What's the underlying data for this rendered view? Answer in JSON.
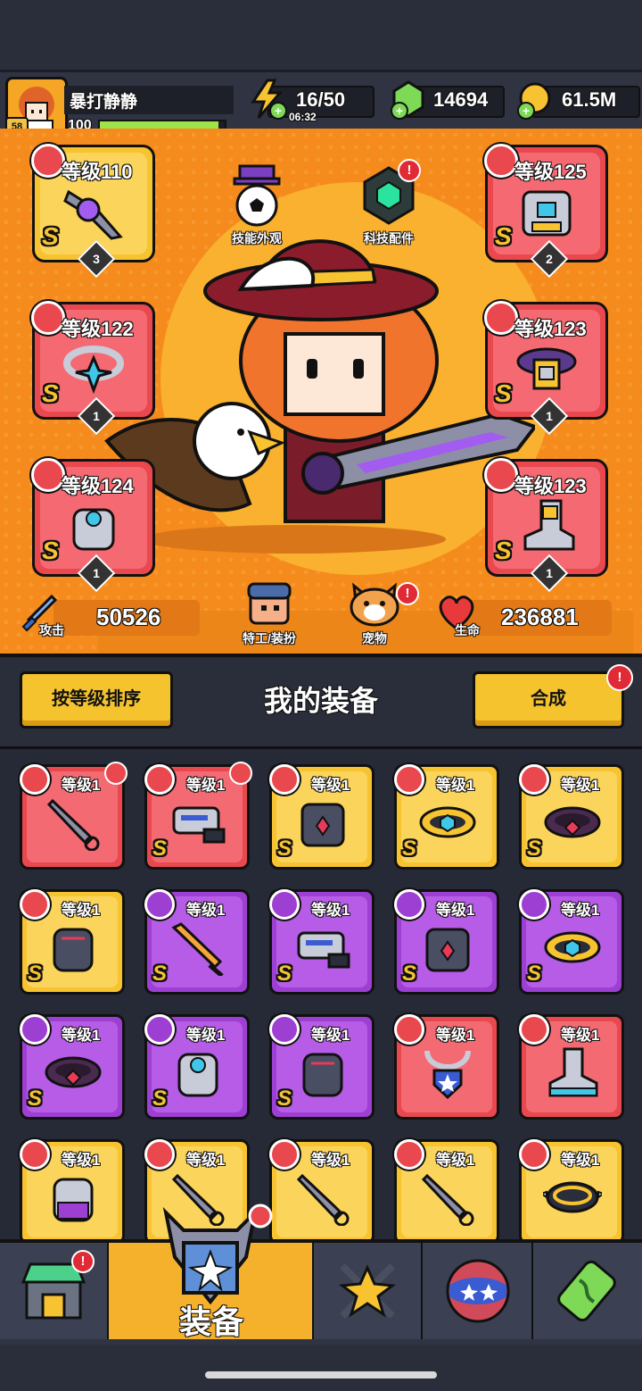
{
  "player": {
    "name": "暴打静静",
    "avatar_level": "58",
    "level": "100",
    "xp_fraction": 0.95
  },
  "resources": {
    "energy": {
      "value": "16/50",
      "timer": "06:32",
      "icon": "lightning-icon"
    },
    "gems": {
      "value": "14694",
      "icon": "green-gem-icon"
    },
    "gold": {
      "value": "61.5M",
      "icon": "gold-coin-icon"
    }
  },
  "hero_slots": [
    {
      "label": "等级110",
      "rank": "S",
      "count": "3",
      "type": "weapon-slot",
      "color": "gold"
    },
    {
      "label": "等级125",
      "rank": "S",
      "count": "2",
      "type": "armor-slot",
      "color": "red"
    },
    {
      "label": "等级122",
      "rank": "S",
      "count": "1",
      "type": "necklace-slot",
      "color": "red"
    },
    {
      "label": "等级123",
      "rank": "S",
      "count": "1",
      "type": "belt-slot",
      "color": "red"
    },
    {
      "label": "等级124",
      "rank": "S",
      "count": "1",
      "type": "glove-slot",
      "color": "red"
    },
    {
      "label": "等级123",
      "rank": "S",
      "count": "1",
      "type": "boot-slot",
      "color": "red"
    }
  ],
  "hero_buttons": {
    "skin": "技能外观",
    "tech": "科技配件",
    "agent": "特工/装扮",
    "pet": "宠物",
    "alert": "!"
  },
  "stats": {
    "attack_label": "攻击",
    "attack_value": "50526",
    "hp_label": "生命",
    "hp_value": "236881"
  },
  "equipment": {
    "sort_button": "按等级排序",
    "title": "我的装备",
    "merge_button": "合成",
    "alert": "!"
  },
  "items": [
    {
      "label": "等级1",
      "rank": "",
      "color": "r",
      "icon": "weapon-icon",
      "art": "kunai"
    },
    {
      "label": "等级1",
      "rank": "S",
      "color": "r",
      "icon": "weapon-icon",
      "art": "gun"
    },
    {
      "label": "等级1",
      "rank": "S",
      "color": "y",
      "icon": "armor-icon",
      "art": "armor"
    },
    {
      "label": "等级1",
      "rank": "S",
      "color": "y",
      "icon": "belt-icon",
      "art": "belt"
    },
    {
      "label": "等级1",
      "rank": "S",
      "color": "y",
      "icon": "belt-icon",
      "art": "belt-dark"
    },
    {
      "label": "等级1",
      "rank": "S",
      "color": "y",
      "icon": "glove-icon",
      "art": "glove"
    },
    {
      "label": "等级1",
      "rank": "S",
      "color": "p",
      "icon": "weapon-icon",
      "art": "sword"
    },
    {
      "label": "等级1",
      "rank": "S",
      "color": "p",
      "icon": "weapon-icon",
      "art": "gun"
    },
    {
      "label": "等级1",
      "rank": "S",
      "color": "p",
      "icon": "armor-icon",
      "art": "armor"
    },
    {
      "label": "等级1",
      "rank": "S",
      "color": "p",
      "icon": "belt-icon",
      "art": "belt"
    },
    {
      "label": "等级1",
      "rank": "S",
      "color": "p",
      "icon": "belt-icon",
      "art": "belt-dark"
    },
    {
      "label": "等级1",
      "rank": "S",
      "color": "p",
      "icon": "glove-icon",
      "art": "gauntlet"
    },
    {
      "label": "等级1",
      "rank": "S",
      "color": "p",
      "icon": "glove-icon",
      "art": "glove"
    },
    {
      "label": "等级1",
      "rank": "",
      "color": "r",
      "icon": "necklace-icon",
      "art": "necklace"
    },
    {
      "label": "等级1",
      "rank": "",
      "color": "r",
      "icon": "boot-icon",
      "art": "boot"
    },
    {
      "label": "等级1",
      "rank": "",
      "color": "y",
      "icon": "glove-icon",
      "art": "gauntlet-purple"
    },
    {
      "label": "等级1",
      "rank": "",
      "color": "y",
      "icon": "weapon-icon",
      "art": "kunai"
    },
    {
      "label": "等级1",
      "rank": "",
      "color": "y",
      "icon": "weapon-icon",
      "art": "kunai"
    },
    {
      "label": "等级1",
      "rank": "",
      "color": "y",
      "icon": "weapon-icon",
      "art": "kunai"
    },
    {
      "label": "等级1",
      "rank": "",
      "color": "y",
      "icon": "necklace-icon",
      "art": "spiked-collar"
    }
  ],
  "nav": {
    "items": [
      {
        "name": "shop-tab",
        "icon": "shop-icon"
      },
      {
        "name": "equipment-tab",
        "icon": "shield-icon",
        "label": "装备"
      },
      {
        "name": "battle-tab",
        "icon": "crossed-swords-star-icon"
      },
      {
        "name": "events-tab",
        "icon": "stars-ball-icon"
      },
      {
        "name": "lab-tab",
        "icon": "dna-capsule-icon"
      }
    ],
    "active_label": "装备"
  },
  "colors": {
    "hero_bg": "#f58b1c",
    "gold": "#f7c330",
    "red": "#e9484f",
    "purple": "#9e3fd3",
    "dark": "#2a2d3a"
  }
}
